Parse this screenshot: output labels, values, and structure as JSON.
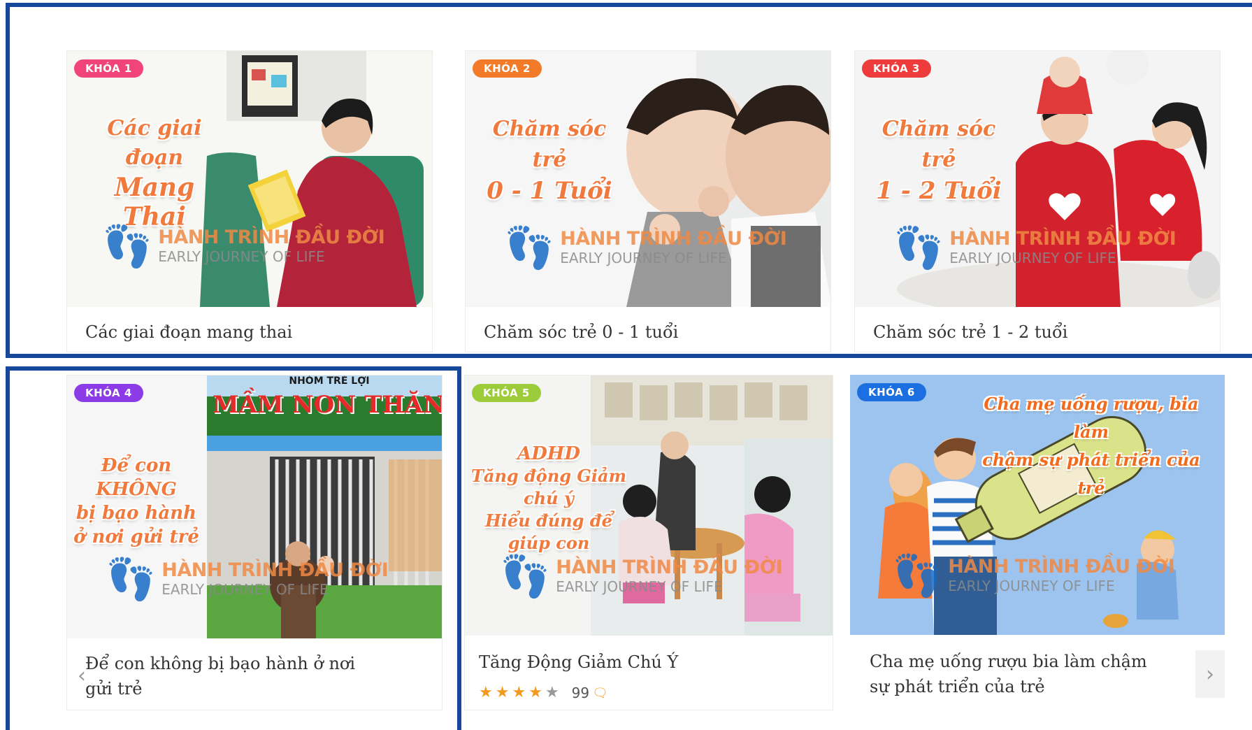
{
  "courses": [
    {
      "badge": "KHÓA 1",
      "badge_color": "#f0447a",
      "headline_1": "Các giai đoạn",
      "headline_2": "Mang Thai",
      "title": "Các giai đoạn mang thai"
    },
    {
      "badge": "KHÓA 2",
      "badge_color": "#f27b2a",
      "headline_1": "Chăm sóc trẻ",
      "headline_2": "0 - 1 Tuổi",
      "title": "Chăm sóc trẻ 0 - 1 tuổi"
    },
    {
      "badge": "KHÓA 3",
      "badge_color": "#ee3b3b",
      "headline_1": "Chăm sóc trẻ",
      "headline_2": "1 - 2 Tuổi",
      "title": "Chăm sóc trẻ 1 - 2 tuổi"
    },
    {
      "badge": "KHÓA 4",
      "badge_color": "#8c3ce6",
      "headline_1": "Để con KHÔNG",
      "headline_2": "bị bạo hành",
      "headline_3": "ở nơi gửi trẻ",
      "signboard_top": "NHÓM TRẺ LỢI",
      "signboard": "MẦM NON THĂNG LO",
      "title": "Để con không bị bạo hành ở nơi gửi trẻ"
    },
    {
      "badge": "KHÓA 5",
      "badge_color": "#9ccc3a",
      "headline_1": "ADHD",
      "headline_2": "Tăng động Giảm chú ý",
      "headline_3": "Hiểu đúng để giúp con",
      "title": "Tăng Động Giảm Chú Ý",
      "rating": 4.5,
      "comments": "99"
    },
    {
      "badge": "KHÓA 6",
      "badge_color": "#1c6fe0",
      "headline_1": "Cha mẹ uống rượu, bia làm",
      "headline_2": "chậm sự phát triển của trẻ",
      "title": "Cha mẹ uống rượu bia làm chậm sự phát triển của trẻ"
    }
  ],
  "brand": {
    "name": "HÀNH TRÌNH ĐẦU ĐỜI",
    "sub": "EARLY JOURNEY OF LIFE",
    "feet": "👣"
  },
  "nav": {
    "prev": "‹",
    "next": "›"
  },
  "colors": {
    "frame": "#16489a",
    "headline": "#f07a3d",
    "star": "#f39a1c"
  }
}
